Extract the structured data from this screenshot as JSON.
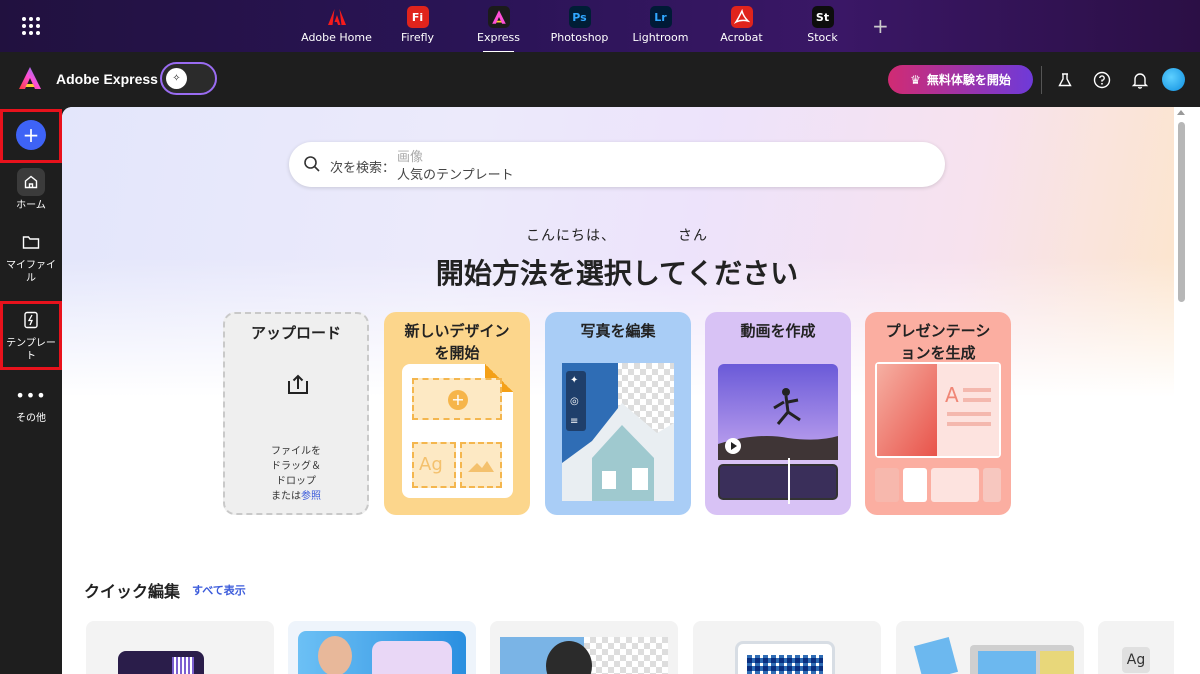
{
  "top_apps": [
    {
      "label": "Adobe Home",
      "mark": "A",
      "color": "#e0241c",
      "icon": "adobe-home-icon"
    },
    {
      "label": "Firefly",
      "mark": "Fi",
      "color": "#e0241c",
      "icon": "firefly-icon"
    },
    {
      "label": "Express",
      "mark": "",
      "color": "#1b1b1b",
      "icon": "express-icon",
      "active": true
    },
    {
      "label": "Photoshop",
      "mark": "Ps",
      "color": "#001e36",
      "icon": "photoshop-icon"
    },
    {
      "label": "Lightroom",
      "mark": "Lr",
      "color": "#001a36",
      "icon": "lightroom-icon"
    },
    {
      "label": "Acrobat",
      "mark": "",
      "color": "#e0241c",
      "icon": "acrobat-icon"
    },
    {
      "label": "Stock",
      "mark": "St",
      "color": "#0d0d0d",
      "icon": "stock-icon"
    }
  ],
  "header": {
    "app_name": "Adobe Express",
    "trial_button": "無料体験を開始"
  },
  "sidebar": {
    "items": [
      {
        "label": "ホーム",
        "icon": "home-icon"
      },
      {
        "label": "マイファイル",
        "icon": "folder-icon"
      },
      {
        "label": "テンプレート",
        "icon": "template-icon"
      },
      {
        "label": "その他",
        "icon": "more-icon"
      }
    ]
  },
  "search": {
    "label": "次を検索：",
    "placeholder_line1": "画像",
    "placeholder_line2": "人気のテンプレート"
  },
  "hero": {
    "greeting_start": "こんにちは、",
    "greeting_end": "さん",
    "headline": "開始方法を選択してください"
  },
  "cards": {
    "upload": {
      "title": "アップロード",
      "line1": "ファイルを",
      "line2": "ドラッグ＆",
      "line3": "ドロップ",
      "line4_prefix": "または",
      "line4_link": "参照"
    },
    "new_design": {
      "title_line1": "新しいデザイン",
      "title_line2": "を開始",
      "ag": "Ag"
    },
    "edit_photo": {
      "title": "写真を編集"
    },
    "make_video": {
      "title": "動画を作成"
    },
    "presentation": {
      "title_line1": "プレゼンテーシ",
      "title_line2": "ョンを生成"
    }
  },
  "quick": {
    "title": "クイック編集",
    "show_all": "すべて表示",
    "ag": "Ag"
  }
}
